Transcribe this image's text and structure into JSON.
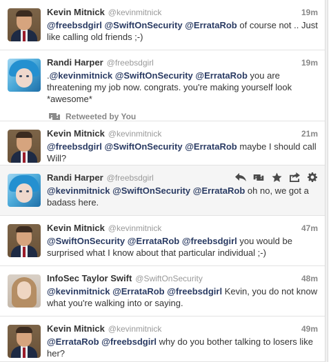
{
  "timeline": {
    "tweets": [
      {
        "name": "Kevin Mitnick",
        "handle": "@kevinmitnick",
        "time": "19m",
        "segments": [
          {
            "t": "@freebsdgirl",
            "m": true
          },
          {
            "t": " ",
            "m": false
          },
          {
            "t": "@SwiftOnSecurity",
            "m": true
          },
          {
            "t": " ",
            "m": false
          },
          {
            "t": "@ErrataRob",
            "m": true
          },
          {
            "t": " of course not .. Just like calling old friends ;-)",
            "m": false
          }
        ]
      },
      {
        "name": "Randi Harper",
        "handle": "@freebsdgirl",
        "time": "19m",
        "segments": [
          {
            "t": ".",
            "m": false
          },
          {
            "t": "@kevinmitnick",
            "m": true
          },
          {
            "t": " ",
            "m": false
          },
          {
            "t": "@SwiftOnSecurity",
            "m": true
          },
          {
            "t": " ",
            "m": false
          },
          {
            "t": "@ErrataRob",
            "m": true
          },
          {
            "t": " you are threatening my job now. congrats. you're making yourself look *awesome*",
            "m": false
          }
        ],
        "retweeted_label": "Retweeted by You"
      },
      {
        "name": "Kevin Mitnick",
        "handle": "@kevinmitnick",
        "time": "21m",
        "segments": [
          {
            "t": "@freebsdgirl",
            "m": true
          },
          {
            "t": " ",
            "m": false
          },
          {
            "t": "@SwiftOnSecurity",
            "m": true
          },
          {
            "t": " ",
            "m": false
          },
          {
            "t": "@ErrataRob",
            "m": true
          },
          {
            "t": " maybe I should call Will?",
            "m": false
          }
        ]
      },
      {
        "name": "Randi Harper",
        "handle": "@freebsdgirl",
        "segments": [
          {
            "t": "@kevinmitnick",
            "m": true
          },
          {
            "t": " ",
            "m": false
          },
          {
            "t": "@SwiftOnSecurity",
            "m": true
          },
          {
            "t": " ",
            "m": false
          },
          {
            "t": "@ErrataRob",
            "m": true
          },
          {
            "t": " oh no, we got a badass here.",
            "m": false
          }
        ],
        "hover_actions": [
          "reply-icon",
          "retweet-icon",
          "favorite-icon",
          "share-icon",
          "more-icon"
        ]
      },
      {
        "name": "Kevin Mitnick",
        "handle": "@kevinmitnick",
        "time": "47m",
        "segments": [
          {
            "t": "@SwiftOnSecurity",
            "m": true
          },
          {
            "t": " ",
            "m": false
          },
          {
            "t": "@ErrataRob",
            "m": true
          },
          {
            "t": " ",
            "m": false
          },
          {
            "t": "@freebsdgirl",
            "m": true
          },
          {
            "t": " you would be surprised what I know about that particular individual ;-)",
            "m": false
          }
        ]
      },
      {
        "name": "InfoSec Taylor Swift",
        "handle": "@SwiftOnSecurity",
        "time": "48m",
        "segments": [
          {
            "t": "@kevinmitnick",
            "m": true
          },
          {
            "t": " ",
            "m": false
          },
          {
            "t": "@ErrataRob",
            "m": true
          },
          {
            "t": " ",
            "m": false
          },
          {
            "t": "@freebsdgirl",
            "m": true
          },
          {
            "t": " Kevin, you do not know what you're walking into or saying.",
            "m": false
          }
        ]
      },
      {
        "name": "Kevin Mitnick",
        "handle": "@kevinmitnick",
        "time": "49m",
        "segments": [
          {
            "t": "@ErrataRob",
            "m": true
          },
          {
            "t": " ",
            "m": false
          },
          {
            "t": "@freebsdgirl",
            "m": true
          },
          {
            "t": " why do you bother talking to losers like her?",
            "m": false
          }
        ]
      }
    ]
  },
  "colors": {
    "mention": "#2a3b63",
    "muted": "#888888",
    "hover_bg": "#f5f5f5"
  }
}
